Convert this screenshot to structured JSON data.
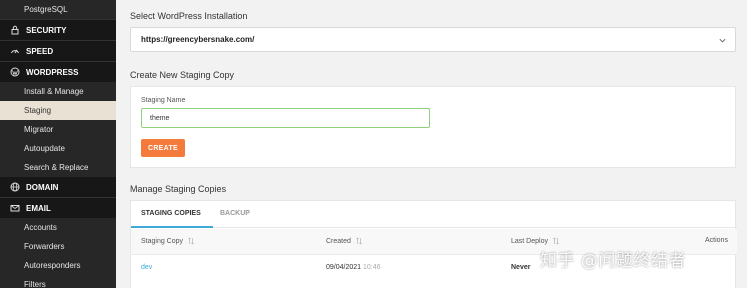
{
  "sidebar": {
    "items": [
      {
        "label": "PostgreSQL",
        "type": "sub"
      },
      {
        "label": "SECURITY",
        "type": "section",
        "icon": "lock-icon"
      },
      {
        "label": "SPEED",
        "type": "section",
        "icon": "speed-icon"
      },
      {
        "label": "WORDPRESS",
        "type": "section",
        "icon": "wordpress-icon"
      },
      {
        "label": "Install & Manage",
        "type": "sub"
      },
      {
        "label": "Staging",
        "type": "sub",
        "active": true
      },
      {
        "label": "Migrator",
        "type": "sub"
      },
      {
        "label": "Autoupdate",
        "type": "sub"
      },
      {
        "label": "Search & Replace",
        "type": "sub"
      },
      {
        "label": "DOMAIN",
        "type": "section",
        "icon": "globe-icon"
      },
      {
        "label": "EMAIL",
        "type": "section",
        "icon": "mail-icon"
      },
      {
        "label": "Accounts",
        "type": "sub"
      },
      {
        "label": "Forwarders",
        "type": "sub"
      },
      {
        "label": "Autoresponders",
        "type": "sub"
      },
      {
        "label": "Filters",
        "type": "sub"
      }
    ]
  },
  "select_install": {
    "title": "Select WordPress Installation",
    "value": "https://greencybersnake.com/"
  },
  "create": {
    "title": "Create New Staging Copy",
    "field_label": "Staging Name",
    "field_value": "theme",
    "button": "CREATE"
  },
  "manage": {
    "title": "Manage Staging Copies",
    "tabs": [
      "STAGING COPIES",
      "BACKUP"
    ],
    "columns": [
      "Staging Copy",
      "Created",
      "Last Deploy",
      "Actions"
    ],
    "rows": [
      {
        "name": "dev",
        "created_date": "09/04/2021",
        "created_time": "10:46",
        "last_deploy": "Never"
      }
    ]
  },
  "watermark": "知乎 @问题终结者",
  "colors": {
    "accent": "#3fa9d8",
    "button": "#f47b3c",
    "input_border": "#8fd17a",
    "sidebar": "#1f1f1f",
    "active_item": "#e9e1d4"
  }
}
